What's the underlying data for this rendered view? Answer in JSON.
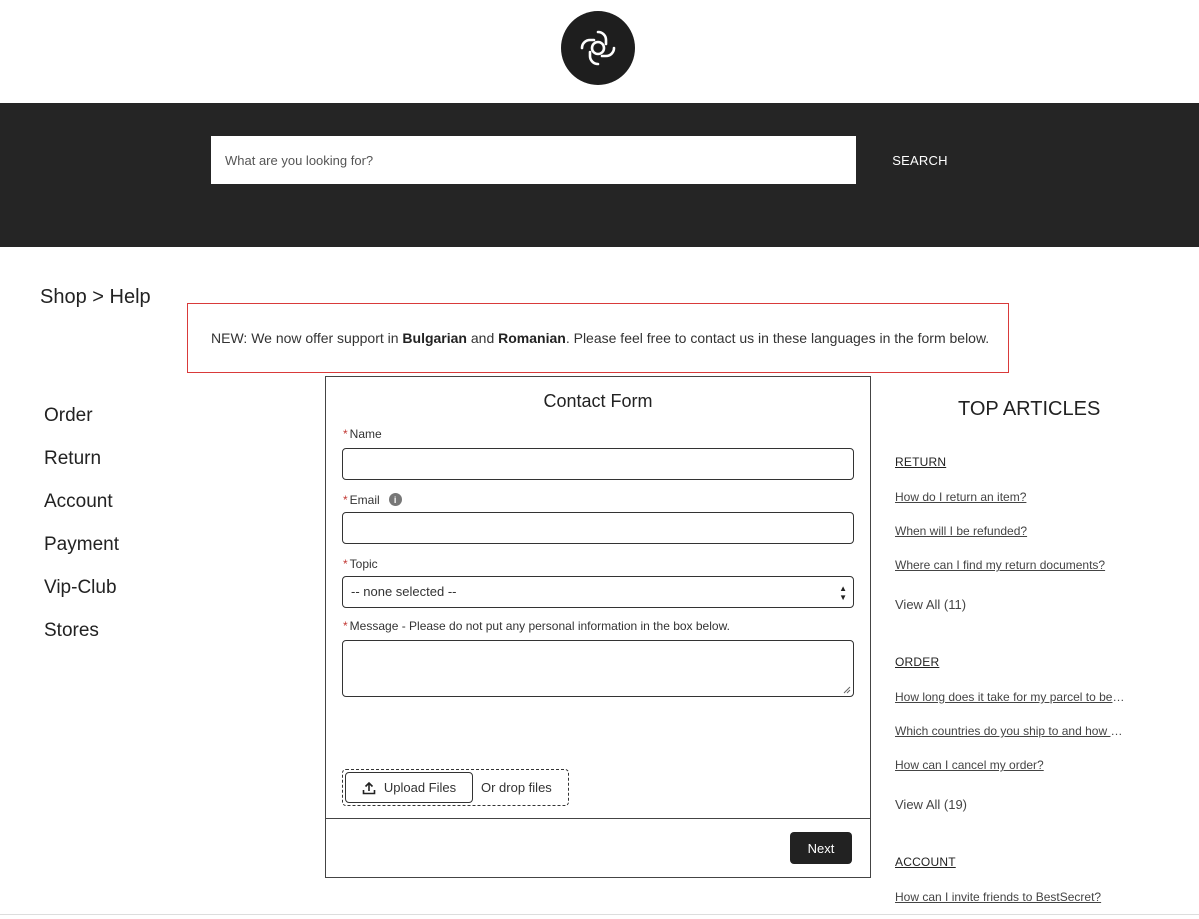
{
  "header": {
    "logo_icon": "brand-knot-logo-icon",
    "search": {
      "placeholder": "What are you looking for?",
      "button_label": "SEARCH"
    }
  },
  "breadcrumb": "Shop > Help",
  "notice": {
    "prefix": "NEW: We now offer support in ",
    "lang1": "Bulgarian",
    "middle": " and ",
    "lang2": "Romanian",
    "suffix": ". Please feel free to contact us in these languages in the form below.",
    "border_color": "#d93a3a"
  },
  "side_nav": {
    "items": [
      "Order",
      "Return",
      "Account",
      "Payment",
      "Vip-Club",
      "Stores"
    ]
  },
  "contact_form": {
    "title": "Contact Form",
    "name_label": "Name",
    "email_label": "Email",
    "topic_label": "Topic",
    "topic_value": "-- none selected --",
    "message_label": "Message - Please do not put any personal information in the box below.",
    "upload_label": "Upload Files",
    "drop_label": "Or drop files",
    "next_label": "Next",
    "required_marker": "*"
  },
  "top_articles": {
    "title": "TOP ARTICLES",
    "sections": [
      {
        "category": "RETURN",
        "links": [
          "How do I return an item?",
          "When will I be refunded?",
          "Where can I find my return documents?"
        ],
        "view_all": "View All (11)"
      },
      {
        "category": "ORDER",
        "links": [
          "How long does it take for my parcel to be delivered?",
          "Which countries do you ship to and how much does it cost?",
          "How can I cancel my order?"
        ],
        "view_all": "View All (19)"
      },
      {
        "category": "ACCOUNT",
        "links": [
          "How can I invite friends to BestSecret?"
        ]
      }
    ]
  },
  "colors": {
    "header_band": "#252525",
    "button_dark": "#222222",
    "required": "#c23934"
  }
}
